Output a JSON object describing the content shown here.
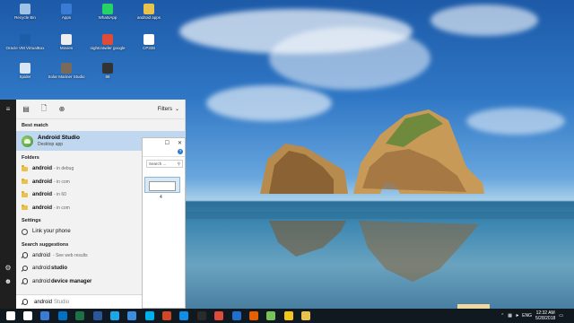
{
  "desktop": {
    "icons": [
      {
        "label": "Recycle Bin",
        "color": "#9fc3e6"
      },
      {
        "label": "Apps",
        "color": "#3a7bd5"
      },
      {
        "label": "WhatsApp",
        "color": "#25d366"
      },
      {
        "label": "android apps",
        "color": "#e8c24a"
      },
      {
        "label": "Oracle VM VirtualBox",
        "color": "#1c5fa8"
      },
      {
        "label": "Movies",
        "color": "#eeeeee"
      },
      {
        "label": "nightcrawler google",
        "color": "#dd4b39"
      },
      {
        "label": "CP338",
        "color": "#ffffff"
      },
      {
        "label": "Spider",
        "color": "#d8e6f5"
      },
      {
        "label": "Solar Mariner Studio",
        "color": "#7a6a5a"
      },
      {
        "label": "88",
        "color": "#333333"
      }
    ]
  },
  "start_rail": {
    "menu_icon": "hamburger-icon",
    "settings_icon": "gear-icon",
    "user_icon": "user-icon"
  },
  "search_panel": {
    "filters_label": "Filters",
    "best_match_header": "Best match",
    "best_match": {
      "name": "Android Studio",
      "type": "Desktop app"
    },
    "folders_header": "Folders",
    "folders": [
      {
        "name": "android",
        "location": "- in debug"
      },
      {
        "name": "android",
        "location": "- in com"
      },
      {
        "name": "android",
        "location": "- in 60"
      },
      {
        "name": "android",
        "location": "- in com"
      }
    ],
    "settings_header": "Settings",
    "settings": [
      {
        "name": "Link your phone"
      }
    ],
    "suggestions_header": "Search suggestions",
    "suggestions": [
      {
        "prefix": "android",
        "bold": "",
        "suffix": "- See web results"
      },
      {
        "prefix": "android ",
        "bold": "studio",
        "suffix": ""
      },
      {
        "prefix": "android ",
        "bold": "device manager",
        "suffix": ""
      }
    ],
    "search_typed": "android",
    "search_ghost": "Studio"
  },
  "explorer": {
    "search_placeholder": "Search ...",
    "help": "?",
    "item_count": "4"
  },
  "taskbar": {
    "icons": [
      {
        "name": "start-icon",
        "color": "#ffffff"
      },
      {
        "name": "search-icon",
        "color": "#ffffff"
      },
      {
        "name": "task-view-icon",
        "color": "#3a7bd5"
      },
      {
        "name": "outlook-icon",
        "color": "#0072c6"
      },
      {
        "name": "excel-icon",
        "color": "#1e7145"
      },
      {
        "name": "word-icon",
        "color": "#2b579a"
      },
      {
        "name": "app-icon",
        "color": "#1aa6e8"
      },
      {
        "name": "maps-icon",
        "color": "#3f8be0"
      },
      {
        "name": "skype-icon",
        "color": "#00aff0"
      },
      {
        "name": "powerpoint-icon",
        "color": "#d24726"
      },
      {
        "name": "teamviewer-icon",
        "color": "#0e8ee9"
      },
      {
        "name": "camera-icon",
        "color": "#2b2b2b"
      },
      {
        "name": "chrome-icon",
        "color": "#dd4b39"
      },
      {
        "name": "edge-icon",
        "color": "#1e6fcf"
      },
      {
        "name": "firefox-icon",
        "color": "#e66000"
      },
      {
        "name": "android-studio-icon",
        "color": "#78c257"
      },
      {
        "name": "sticky-notes-icon",
        "color": "#f4c61c"
      },
      {
        "name": "file-explorer-icon",
        "color": "#e8c24a"
      }
    ],
    "tray_language": "ENG",
    "time": "12:32 AM",
    "date": "5/28/2018"
  }
}
